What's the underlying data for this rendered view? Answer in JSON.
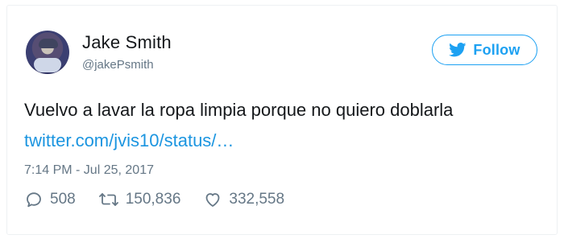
{
  "user": {
    "name": "Jake Smith",
    "handle": "@jakePsmith"
  },
  "follow_button": {
    "label": "Follow",
    "icon": "twitter-bird-icon",
    "color": "#1da1f2"
  },
  "tweet": {
    "text": "Vuelvo a lavar la ropa limpia porque no quiero doblarla",
    "link": "twitter.com/jvis10/status/…",
    "link_color": "#1b95e0",
    "timestamp": "7:14 PM - Jul 25, 2017"
  },
  "actions": {
    "replies": {
      "icon": "reply-icon",
      "count": "508"
    },
    "retweets": {
      "icon": "retweet-icon",
      "count": "150,836"
    },
    "likes": {
      "icon": "heart-icon",
      "count": "332,558"
    }
  }
}
